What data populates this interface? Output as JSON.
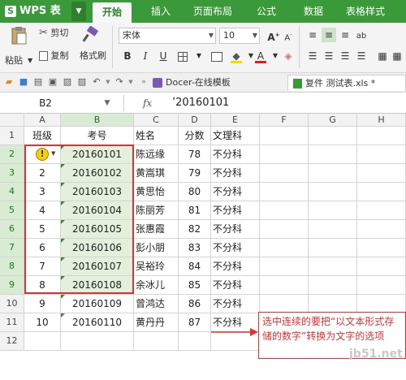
{
  "app": {
    "logo": "WPS 表格",
    "logo_letter": "S"
  },
  "tabs": [
    {
      "label": "开始",
      "active": true
    },
    {
      "label": "插入"
    },
    {
      "label": "页面布局"
    },
    {
      "label": "公式"
    },
    {
      "label": "数据"
    },
    {
      "label": "表格样式"
    }
  ],
  "ribbon": {
    "paste": "粘贴",
    "cut": "剪切",
    "copy": "复制",
    "format_painter": "格式刷",
    "font_name": "宋体",
    "font_size": "10",
    "bold": "B",
    "italic": "I",
    "underline": "U",
    "font_color_label": "A",
    "grow_font": "A",
    "shrink_font": "A"
  },
  "quickbar": {
    "doc_tab_1": "Docer-在线模板",
    "doc_tab_2": "复件 测试表.xls *"
  },
  "formula_bar": {
    "cell_ref": "B2",
    "fx": "fx",
    "value": "’20160101"
  },
  "sheet": {
    "columns": [
      "A",
      "B",
      "C",
      "D",
      "E",
      "F",
      "G",
      "H"
    ],
    "rows": [
      {
        "num": "1",
        "cells": [
          "班级",
          "考号",
          "姓名",
          "分数",
          "文理科"
        ]
      },
      {
        "num": "2",
        "cells": [
          "",
          "20160101",
          "陈远缘",
          "78",
          "不分科"
        ]
      },
      {
        "num": "3",
        "cells": [
          "2",
          "20160102",
          "黄嵩琪",
          "79",
          "不分科"
        ]
      },
      {
        "num": "4",
        "cells": [
          "3",
          "20160103",
          "黄思怡",
          "80",
          "不分科"
        ]
      },
      {
        "num": "5",
        "cells": [
          "4",
          "20160104",
          "陈丽芳",
          "81",
          "不分科"
        ]
      },
      {
        "num": "6",
        "cells": [
          "5",
          "20160105",
          "张惠霞",
          "82",
          "不分科"
        ]
      },
      {
        "num": "7",
        "cells": [
          "6",
          "20160106",
          "彭小朋",
          "83",
          "不分科"
        ]
      },
      {
        "num": "8",
        "cells": [
          "7",
          "20160107",
          "吴裕玲",
          "84",
          "不分科"
        ]
      },
      {
        "num": "9",
        "cells": [
          "8",
          "20160108",
          "余冰儿",
          "85",
          "不分科"
        ]
      },
      {
        "num": "10",
        "cells": [
          "9",
          "20160109",
          "曾鸿达",
          "86",
          "不分科"
        ]
      },
      {
        "num": "11",
        "cells": [
          "10",
          "20160110",
          "黄丹丹",
          "87",
          "不分科"
        ]
      },
      {
        "num": "12",
        "cells": [
          "",
          "",
          "",
          "",
          ""
        ]
      }
    ]
  },
  "annotation": {
    "text": "选中连续的要把“以文本形式存储的数字”转换为文字的选项"
  },
  "watermark": "jb51.net",
  "colors": {
    "accent": "#3a9a3a",
    "annotation": "#e03030",
    "selection": "#e3f1dc"
  }
}
